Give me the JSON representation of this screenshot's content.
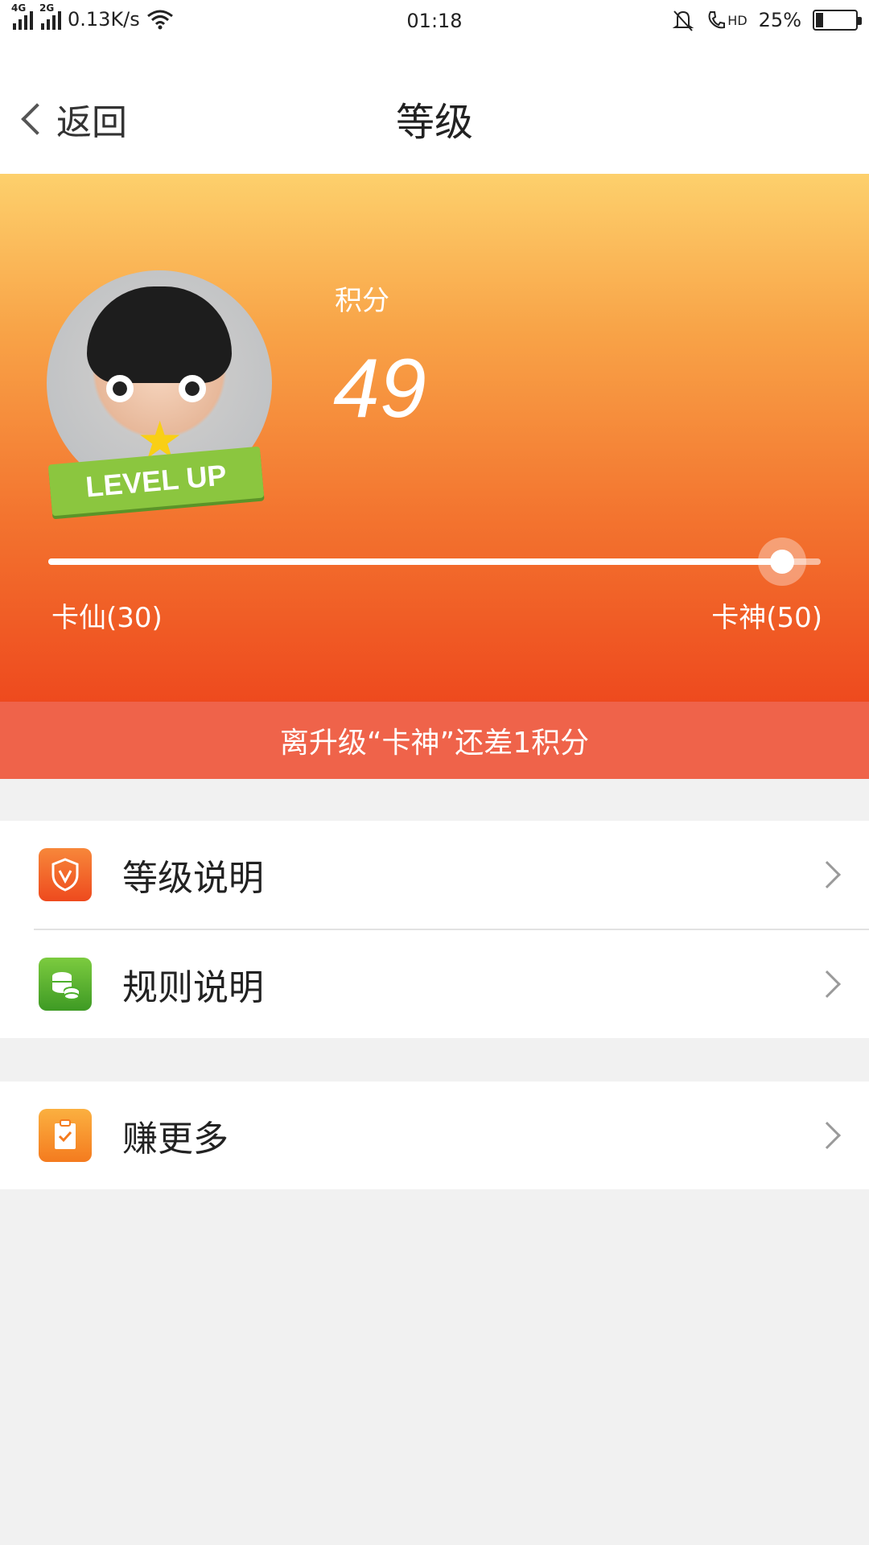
{
  "status_bar": {
    "net_4g": "4G",
    "net_2g": "2G",
    "speed": "0.13K/s",
    "time": "01:18",
    "hd": "HD",
    "battery_text": "25%",
    "battery_level": 0.25
  },
  "nav": {
    "back_label": "返回",
    "title": "等级"
  },
  "hero": {
    "avatar_badge": "LEVEL UP",
    "points_label": "积分",
    "points_value": "49",
    "progress_fraction": 0.95,
    "level_current": "卡仙(30)",
    "level_next": "卡神(50)",
    "notice": "离升级“卡神”还差1积分"
  },
  "menu": {
    "group1": [
      {
        "label": "等级说明",
        "icon": "shield-v-icon",
        "color": "#f05a22"
      },
      {
        "label": "规则说明",
        "icon": "coins-icon",
        "color": "#4caf2a"
      }
    ],
    "group2": [
      {
        "label": "赚更多",
        "icon": "clipboard-check-icon",
        "color": "#f7941d"
      }
    ]
  }
}
